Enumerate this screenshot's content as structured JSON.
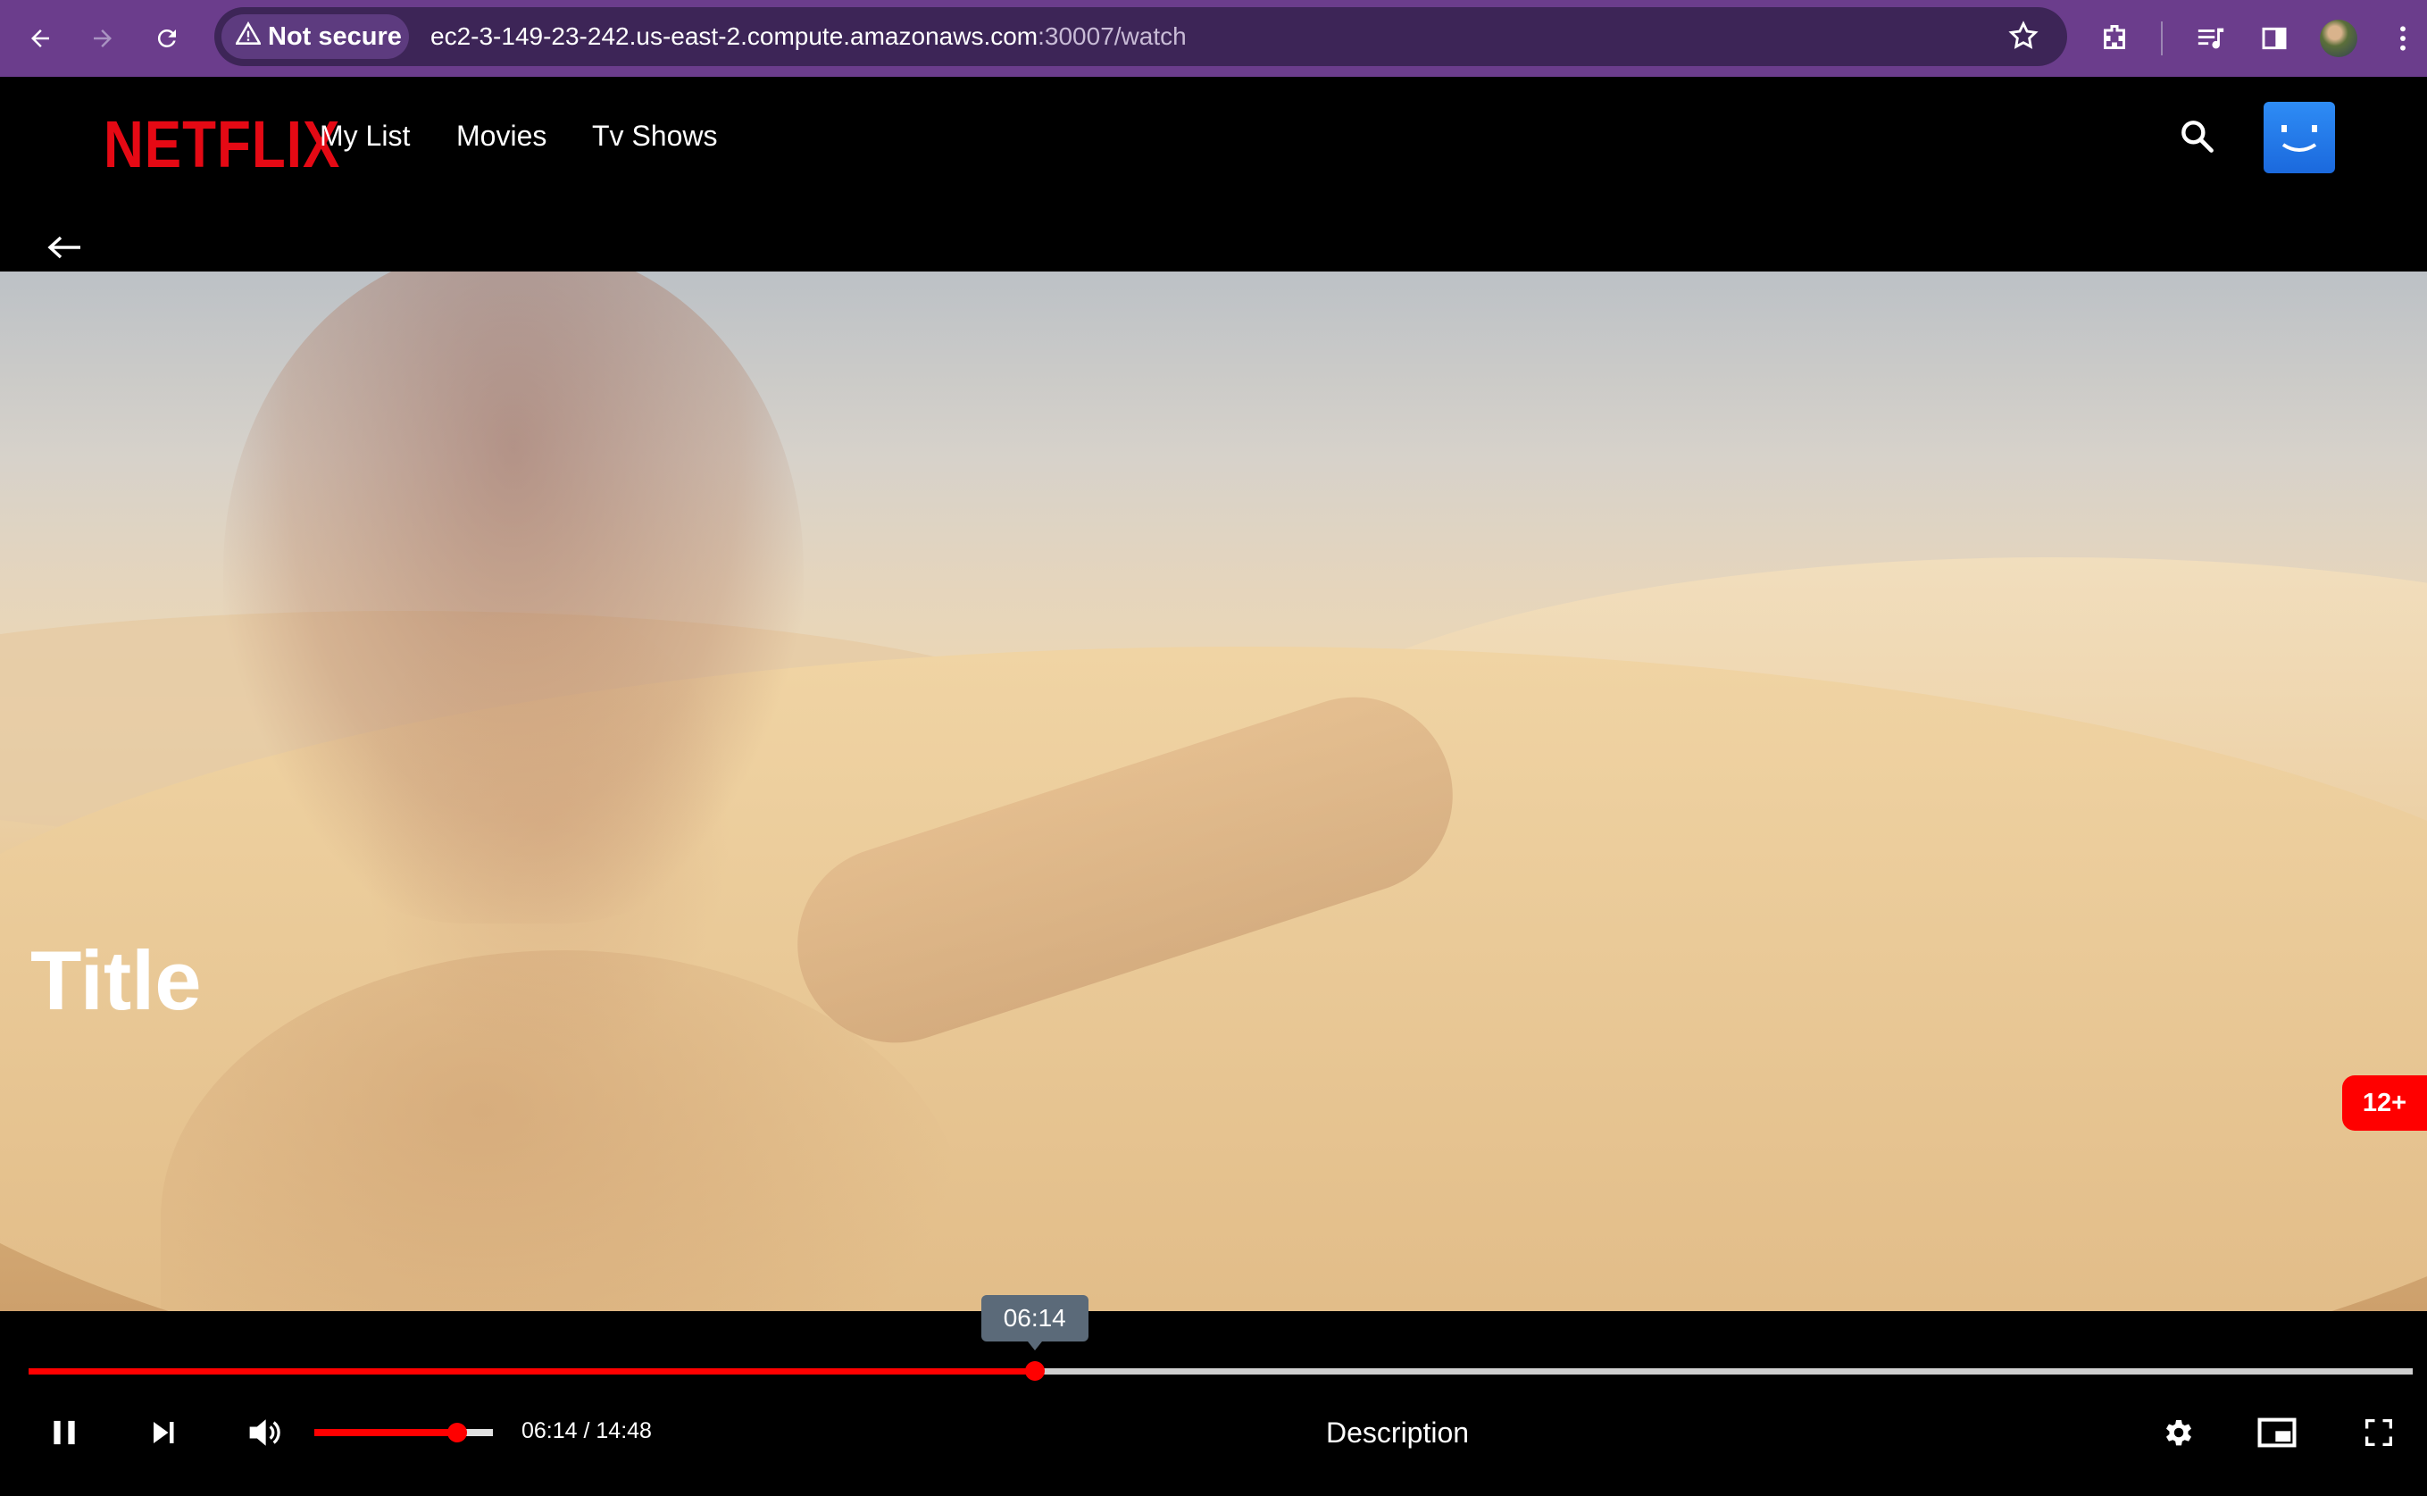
{
  "browser": {
    "security_label": "Not secure",
    "url_host": "ec2-3-149-23-242.us-east-2.compute.amazonaws.com",
    "url_path": ":30007/watch"
  },
  "header": {
    "logo": "NETFLIX",
    "nav": [
      "My List",
      "Movies",
      "Tv Shows"
    ]
  },
  "video": {
    "title": "Title",
    "rating": "12+"
  },
  "player": {
    "tooltip_time": "06:14",
    "current_time": "06:14",
    "duration": "14:48",
    "time_display": "06:14 / 14:48",
    "progress": 0.422,
    "volume": 0.8,
    "description": "Description"
  },
  "colors": {
    "brand": "#e50914",
    "accent": "#ff0000",
    "chrome": "#6b3d8c"
  },
  "icons": [
    "back-icon",
    "forward-icon",
    "reload-icon",
    "warning-icon",
    "star-icon",
    "extensions-icon",
    "media-icon",
    "sidepanel-icon",
    "menu-icon",
    "search-icon",
    "arrow-left-icon",
    "pause-icon",
    "next-icon",
    "volume-icon",
    "settings-icon",
    "miniplayer-icon",
    "fullscreen-icon"
  ]
}
